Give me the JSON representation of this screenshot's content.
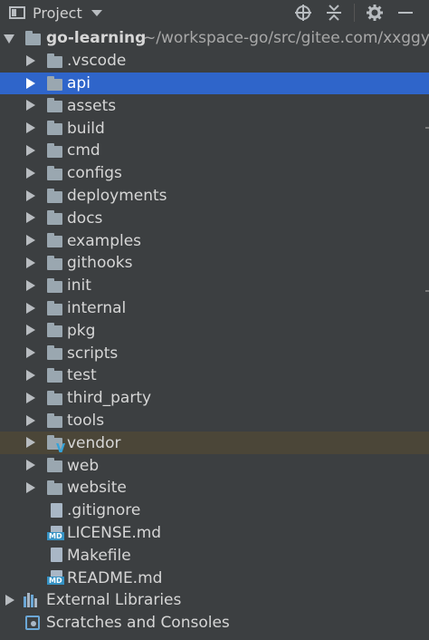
{
  "header": {
    "title": "Project",
    "tools": [
      "locate-icon",
      "collapse-icon",
      "gear-icon",
      "minimize-icon"
    ]
  },
  "root": {
    "name": "go-learning",
    "path": "~/workspace-go/src/gitee.com/xxggy/"
  },
  "items": [
    {
      "type": "folder",
      "label": ".vscode"
    },
    {
      "type": "folder",
      "label": "api",
      "selected": true
    },
    {
      "type": "folder",
      "label": "assets"
    },
    {
      "type": "folder",
      "label": "build"
    },
    {
      "type": "folder",
      "label": "cmd"
    },
    {
      "type": "folder",
      "label": "configs"
    },
    {
      "type": "folder",
      "label": "deployments"
    },
    {
      "type": "folder",
      "label": "docs"
    },
    {
      "type": "folder",
      "label": "examples"
    },
    {
      "type": "folder",
      "label": "githooks"
    },
    {
      "type": "folder",
      "label": "init"
    },
    {
      "type": "folder",
      "label": "internal"
    },
    {
      "type": "folder",
      "label": "pkg"
    },
    {
      "type": "folder",
      "label": "scripts"
    },
    {
      "type": "folder",
      "label": "test"
    },
    {
      "type": "folder",
      "label": "third_party"
    },
    {
      "type": "folder",
      "label": "tools"
    },
    {
      "type": "folder",
      "label": "vendor",
      "vendor": true
    },
    {
      "type": "folder",
      "label": "web"
    },
    {
      "type": "folder",
      "label": "website"
    },
    {
      "type": "file",
      "label": ".gitignore"
    },
    {
      "type": "file-md",
      "label": "LICENSE.md"
    },
    {
      "type": "file",
      "label": "Makefile"
    },
    {
      "type": "file-md",
      "label": "README.md"
    }
  ],
  "footer_items": [
    {
      "label": "External Libraries",
      "icon": "library-icon"
    },
    {
      "label": "Scratches and Consoles",
      "icon": "scratches-icon"
    }
  ],
  "colors": {
    "background": "#3c3f41",
    "selection": "#2f65ca",
    "vendor_highlight": "#4b4638"
  }
}
